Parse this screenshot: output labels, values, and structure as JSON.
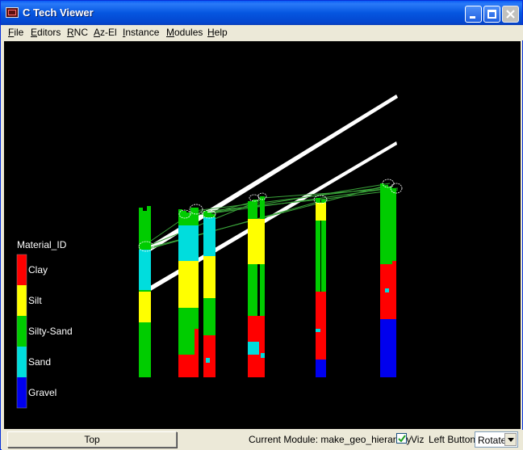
{
  "window": {
    "title": "C Tech Viewer"
  },
  "menu": [
    {
      "label": "File"
    },
    {
      "label": "Editors"
    },
    {
      "label": "RNC"
    },
    {
      "label": "Az-El"
    },
    {
      "label": "Instance"
    },
    {
      "label": "Modules"
    },
    {
      "label": "Help"
    }
  ],
  "legend": {
    "title": "Material_ID",
    "entries": [
      {
        "label": "Clay",
        "color": "#ff0000"
      },
      {
        "label": "Silt",
        "color": "#ffff00"
      },
      {
        "label": "Silty-Sand",
        "color": "#00cc00"
      },
      {
        "label": "Sand",
        "color": "#00dddd"
      },
      {
        "label": "Gravel",
        "color": "#0000ee"
      }
    ]
  },
  "status": {
    "view_button": "Top",
    "current_module_label": "Current Module: make_geo_hierarchy",
    "viz_checked": true,
    "viz_label": "Viz",
    "left_button_label": "Left Button",
    "mode_value": "Rotate"
  }
}
